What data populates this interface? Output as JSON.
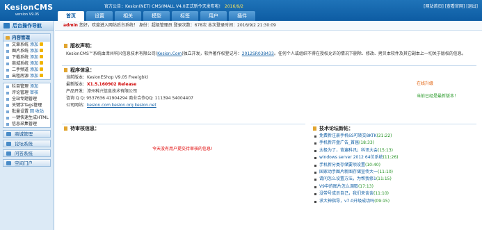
{
  "header": {
    "logo": "KesionCMS",
    "version": "version V9.05",
    "notice_label": "官方公告：",
    "notice_text": "Kesion(NET) CMS/IMALL V4.0正式新今天发布啦!",
    "notice_date": "2016/9/2",
    "top_links": "[网站首页] [查看官网] [退出]",
    "user_line": "用户: admin",
    "tabs": [
      "首页",
      "设置",
      "相关",
      "模型",
      "标签",
      "用户",
      "插件"
    ]
  },
  "sidebar": {
    "title": "后台操作导航",
    "content_group": {
      "title": "内容管理",
      "items": [
        {
          "label": "文章系统",
          "action": "添加"
        },
        {
          "label": "图片系统",
          "action": "添加"
        },
        {
          "label": "下载系统",
          "action": "添加"
        },
        {
          "label": "商城系统",
          "action": "添加"
        },
        {
          "label": "二手频道",
          "action": "添加"
        },
        {
          "label": "出租房源",
          "action": "添加"
        }
      ]
    },
    "misc_group": {
      "items": [
        {
          "label": "栏目管理",
          "action": "添加"
        },
        {
          "label": "评论管理",
          "action": "审核"
        },
        {
          "label": "全站专题管理",
          "action": ""
        },
        {
          "label": "关键字Tags管理",
          "action": ""
        },
        {
          "label": "批量设置",
          "action": "回 收站"
        },
        {
          "label": "一键快速生成HTML",
          "action": ""
        },
        {
          "label": "信息采集管理",
          "action": ""
        }
      ]
    },
    "big_buttons": [
      "商城管理",
      "论坛系统",
      "问答系统",
      "空间门户"
    ]
  },
  "main": {
    "welcome": {
      "user": "admin",
      "text": "您好，欢迎进入网站后台系统！ 身份：超级管理员 登录次数：678次 本次登录时间：2016/9/2 21:30:09"
    },
    "copyright": {
      "title": "版权声明：",
      "text_before": "KesionCMS™系统由漳州科兴信息技术有限公司(",
      "link": "Kesion.Com",
      "text_mid": ")独立开发，软件著作权登记号：",
      "reg": "2012SR038433",
      "text_after": "。任何个人或组织不得在授权允许的情况下删除、修改、拷贝本软件及其它副本上一切关于版权的信息。"
    },
    "program": {
      "title": "程序信息：",
      "current_label": "当前版本：",
      "current_value": "KesionEShop V9.05 Free(gbk)",
      "latest_label": "最新版本：",
      "latest_value": "X1.5.160902 Release",
      "company_label": "产品开发：",
      "company_value": "漳州科兴信息技术有限公司",
      "contact": "咨询 Q Q: 9537636 41904294 商业合作QQ: 111394 54004407",
      "site_label": "公司网站：",
      "site_links": "kesion.com kesion.org kesion.net",
      "upgrade": "在线升级",
      "latest_msg": "当前已经是最新版本！"
    },
    "pending": {
      "title": "待审核信息：",
      "empty": "今天没有用户提交待审核的信息!"
    },
    "news": {
      "title": "技术论坛新帖：",
      "items": [
        {
          "t": "免费新注册手机6S可转交8KTK",
          "d": "(21:22)"
        },
        {
          "t": "手机新开盘广告_首届",
          "d": "(18:33)"
        },
        {
          "t": "太极为了，背遍科讯；科讯大会",
          "d": "(15:13)"
        },
        {
          "t": "windows server 2012 64位系统",
          "d": "(11:26)"
        },
        {
          "t": "手机新分类存储要项设置",
          "d": "(10:40)"
        },
        {
          "t": "国家动手图片新图存储宣传大一",
          "d": "(11:10)"
        },
        {
          "t": "请问怎么设置方法，为帮我修1",
          "d": "(11:15)"
        },
        {
          "t": "V9中的图片怎么调取",
          "d": "(17:13)"
        },
        {
          "t": "没带号成员自己，我们来谈谈",
          "d": "(11:10)"
        },
        {
          "t": "求大神指导，v7.0升级成功吗",
          "d": "(09:15)"
        }
      ]
    }
  }
}
